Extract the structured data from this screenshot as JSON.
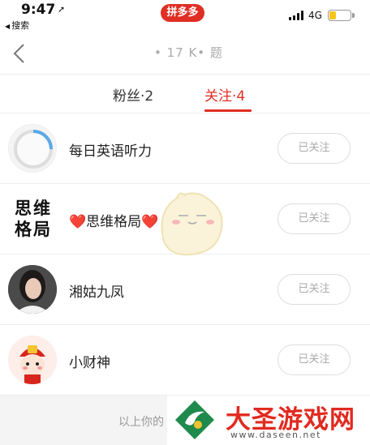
{
  "status_bar": {
    "time": "9:47",
    "back_app_label": "搜索",
    "brand_badge": "拼多多",
    "network": "4G",
    "battery_level": 0.3
  },
  "nav": {
    "title": "• 17 K• 题"
  },
  "tabs": [
    {
      "label": "粉丝·2",
      "active": false
    },
    {
      "label": "关注·4",
      "active": true
    }
  ],
  "following": [
    {
      "name": "每日英语听力",
      "button": "已关注",
      "avatar": "audio-progress-avatar"
    },
    {
      "name": "❤️思维格局❤️",
      "button": "已关注",
      "avatar": "calligraphy-avatar",
      "avatar_text": [
        "思维",
        "格局"
      ]
    },
    {
      "name": "湘姑九凤",
      "button": "已关注",
      "avatar": "person-photo-avatar"
    },
    {
      "name": "小财神",
      "button": "已关注",
      "avatar": "fortune-god-avatar"
    }
  ],
  "footer": {
    "text": "以上你的"
  },
  "watermark": {
    "title": "大圣游戏网",
    "url": "www.daseen.net"
  },
  "colors": {
    "accent": "#e02e24",
    "watermark_red": "#e12a20"
  }
}
